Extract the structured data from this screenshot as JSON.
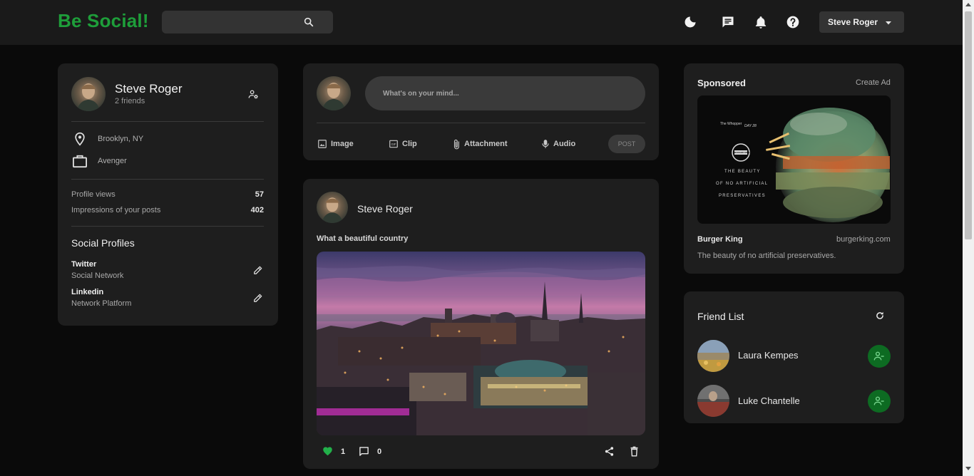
{
  "app": {
    "logo": "Be Social!",
    "accent": "#1e9e3a"
  },
  "search": {
    "placeholder": "",
    "icon": "search-icon"
  },
  "navbar": {
    "icons": [
      "dark-mode-icon",
      "message-icon",
      "notification-icon",
      "help-icon"
    ],
    "user_select": "Steve Roger"
  },
  "profile": {
    "name": "Steve Roger",
    "friends": "2 friends",
    "location": "Brooklyn, NY",
    "occupation": "Avenger",
    "stats": [
      {
        "label": "Profile views",
        "value": "57"
      },
      {
        "label": "Impressions of your posts",
        "value": "402"
      }
    ],
    "social_heading": "Social Profiles",
    "socials": [
      {
        "name": "Twitter",
        "type": "Social Network"
      },
      {
        "name": "Linkedin",
        "type": "Network Platform"
      }
    ]
  },
  "composer": {
    "placeholder": "What's on your mind...",
    "actions": [
      "Image",
      "Clip",
      "Attachment",
      "Audio"
    ],
    "post_button": "POST"
  },
  "post": {
    "author": "Steve Roger",
    "caption": "What a beautiful country",
    "likes": "1",
    "comments": "0"
  },
  "sponsored": {
    "heading": "Sponsored",
    "create_ad": "Create Ad",
    "ad_text_top": "The Whopper",
    "ad_text_day": "DAY 28",
    "ad_brand_mark": "BURGER KING",
    "ad_lines": [
      "THE BEAUTY",
      "OF NO ARTIFICIAL",
      "PRESERVATIVES"
    ],
    "brand": "Burger King",
    "site": "burgerking.com",
    "description": "The beauty of no artificial preservatives."
  },
  "friend_list": {
    "heading": "Friend List",
    "friends": [
      {
        "name": "Laura Kempes"
      },
      {
        "name": "Luke Chantelle"
      }
    ]
  }
}
